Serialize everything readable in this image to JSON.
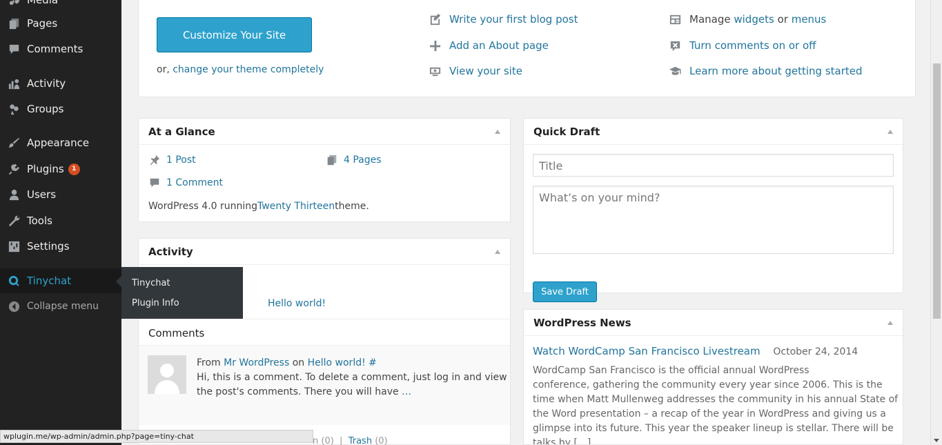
{
  "sidebar": {
    "items": [
      {
        "label": "Media"
      },
      {
        "label": "Pages"
      },
      {
        "label": "Comments"
      },
      {
        "label": "Activity"
      },
      {
        "label": "Groups"
      },
      {
        "label": "Appearance"
      },
      {
        "label": "Plugins",
        "badge": "1"
      },
      {
        "label": "Users"
      },
      {
        "label": "Tools"
      },
      {
        "label": "Settings"
      },
      {
        "label": "Tinychat"
      }
    ],
    "collapse_label": "Collapse menu"
  },
  "flyout": {
    "items": [
      {
        "label": "Tinychat"
      },
      {
        "label": "Plugin Info"
      }
    ]
  },
  "welcome": {
    "customize_label": "Customize Your Site",
    "or_prefix": "or, ",
    "change_theme_link": "change your theme completely",
    "next_steps": [
      {
        "label": "Write your first blog post"
      },
      {
        "label": "Add an About page"
      },
      {
        "label": "View your site"
      }
    ],
    "more_actions": {
      "manage_prefix": "Manage ",
      "widgets_link": "widgets",
      "or_text": " or ",
      "menus_link": "menus",
      "comments_toggle": "Turn comments on or off",
      "learn_more": "Learn more about getting started"
    }
  },
  "glance": {
    "title": "At a Glance",
    "posts": "1 Post",
    "pages": "4 Pages",
    "comments": "1 Comment",
    "wp_prefix": "WordPress 4.0 running",
    "theme_link": "Twenty Thirteen",
    "wp_suffix": "theme."
  },
  "activity": {
    "title": "Activity",
    "recent_post_link": "Hello world!",
    "comments_heading": "Comments",
    "comment": {
      "from_prefix": "From ",
      "author": "Mr WordPress",
      "on_text": " on ",
      "post_link": "Hello world! #",
      "excerpt": "Hi, this is a comment. To delete a comment, just log in and view the post's comments. There you will have",
      "ellipsis": " …"
    },
    "footer_partial": "n (0)",
    "trash_label": "Trash",
    "trash_count": "(0)"
  },
  "quick_draft": {
    "title": "Quick Draft",
    "title_placeholder": "Title",
    "content_placeholder": "What’s on your mind?",
    "save_label": "Save Draft"
  },
  "news": {
    "title": "WordPress News",
    "headline": "Watch WordCamp San Francisco Livestream",
    "date": "October 24, 2014",
    "body_lines": [
      "WordCamp San Francisco is the official annual WordPress",
      "conference, gathering the community every year since 2006. This is the",
      "time when Matt Mullenweg addresses the community in his annual State of",
      "the Word presentation – a recap of  the year in WordPress and giving us a",
      "glimpse into its future. This year the speaker lineup is stellar. There will be",
      "talks by […]"
    ]
  },
  "statusbar": {
    "url": "wplugin.me/wp-admin/admin.php?page=tiny-chat"
  }
}
